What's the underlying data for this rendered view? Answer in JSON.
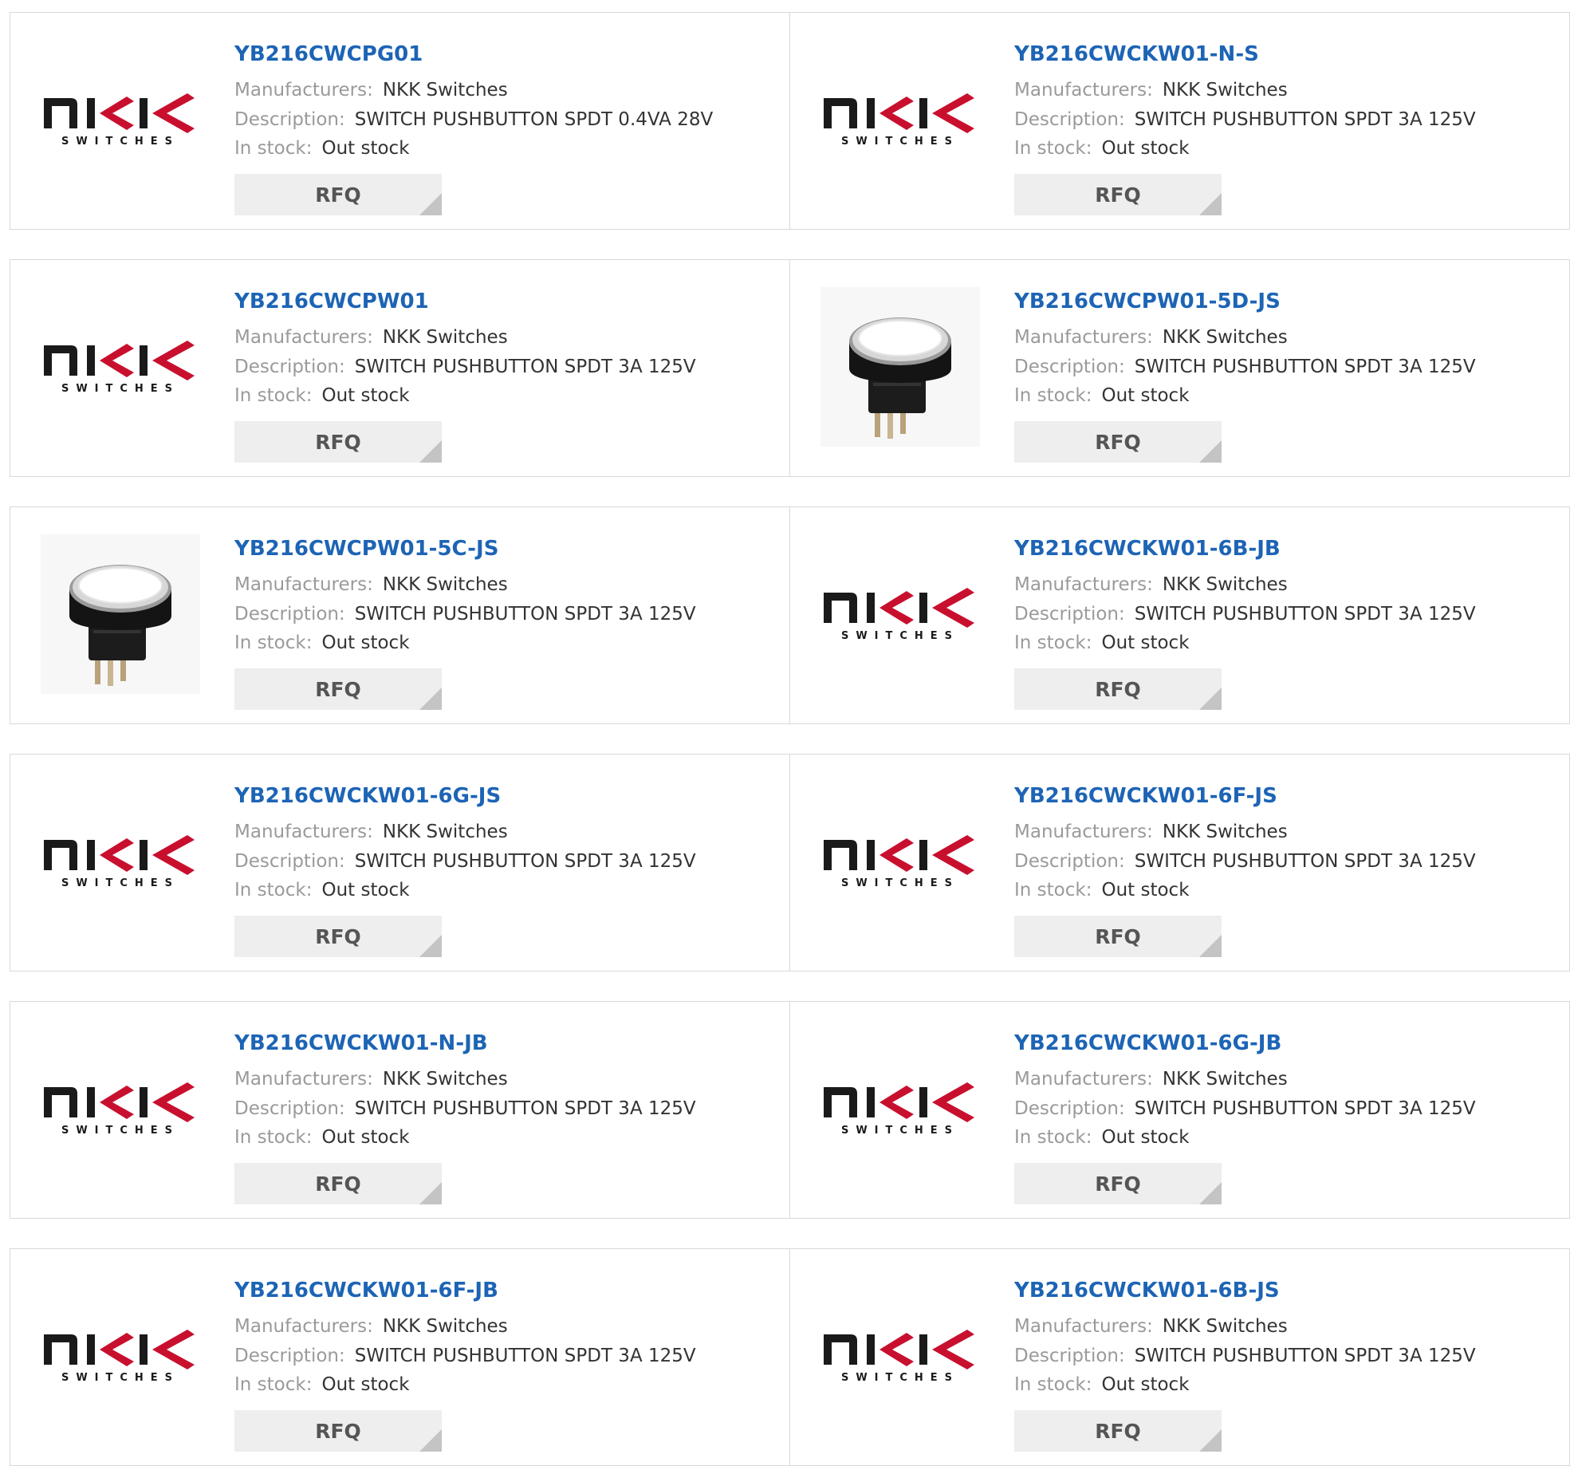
{
  "labels": {
    "manufacturers": "Manufacturers:",
    "description": "Description:",
    "in_stock": "In stock:",
    "rfq": "RFQ"
  },
  "logo": {
    "top_text": "NKK",
    "sub_text": "SWITCHES",
    "color": "#c8102e"
  },
  "colors": {
    "link": "#1d64b5",
    "label": "#9a9a9a",
    "value": "#333333",
    "button_bg": "#eeeeee",
    "border": "#d9d9d9"
  },
  "products": [
    {
      "part": "YB216CWCPG01",
      "manufacturer": "NKK Switches",
      "description": "SWITCH PUSHBUTTON SPDT 0.4VA 28V",
      "stock": "Out stock",
      "image": "nkk-logo"
    },
    {
      "part": "YB216CWCKW01-N-S",
      "manufacturer": "NKK Switches",
      "description": "SWITCH PUSHBUTTON SPDT 3A 125V",
      "stock": "Out stock",
      "image": "nkk-logo"
    },
    {
      "part": "YB216CWCPW01",
      "manufacturer": "NKK Switches",
      "description": "SWITCH PUSHBUTTON SPDT 3A 125V",
      "stock": "Out stock",
      "image": "nkk-logo"
    },
    {
      "part": "YB216CWCPW01-5D-JS",
      "manufacturer": "NKK Switches",
      "description": "SWITCH PUSHBUTTON SPDT 3A 125V",
      "stock": "Out stock",
      "image": "pushbutton-photo"
    },
    {
      "part": "YB216CWCPW01-5C-JS",
      "manufacturer": "NKK Switches",
      "description": "SWITCH PUSHBUTTON SPDT 3A 125V",
      "stock": "Out stock",
      "image": "pushbutton-photo"
    },
    {
      "part": "YB216CWCKW01-6B-JB",
      "manufacturer": "NKK Switches",
      "description": "SWITCH PUSHBUTTON SPDT 3A 125V",
      "stock": "Out stock",
      "image": "nkk-logo"
    },
    {
      "part": "YB216CWCKW01-6G-JS",
      "manufacturer": "NKK Switches",
      "description": "SWITCH PUSHBUTTON SPDT 3A 125V",
      "stock": "Out stock",
      "image": "nkk-logo"
    },
    {
      "part": "YB216CWCKW01-6F-JS",
      "manufacturer": "NKK Switches",
      "description": "SWITCH PUSHBUTTON SPDT 3A 125V",
      "stock": "Out stock",
      "image": "nkk-logo"
    },
    {
      "part": "YB216CWCKW01-N-JB",
      "manufacturer": "NKK Switches",
      "description": "SWITCH PUSHBUTTON SPDT 3A 125V",
      "stock": "Out stock",
      "image": "nkk-logo"
    },
    {
      "part": "YB216CWCKW01-6G-JB",
      "manufacturer": "NKK Switches",
      "description": "SWITCH PUSHBUTTON SPDT 3A 125V",
      "stock": "Out stock",
      "image": "nkk-logo"
    },
    {
      "part": "YB216CWCKW01-6F-JB",
      "manufacturer": "NKK Switches",
      "description": "SWITCH PUSHBUTTON SPDT 3A 125V",
      "stock": "Out stock",
      "image": "nkk-logo"
    },
    {
      "part": "YB216CWCKW01-6B-JS",
      "manufacturer": "NKK Switches",
      "description": "SWITCH PUSHBUTTON SPDT 3A 125V",
      "stock": "Out stock",
      "image": "nkk-logo"
    }
  ]
}
